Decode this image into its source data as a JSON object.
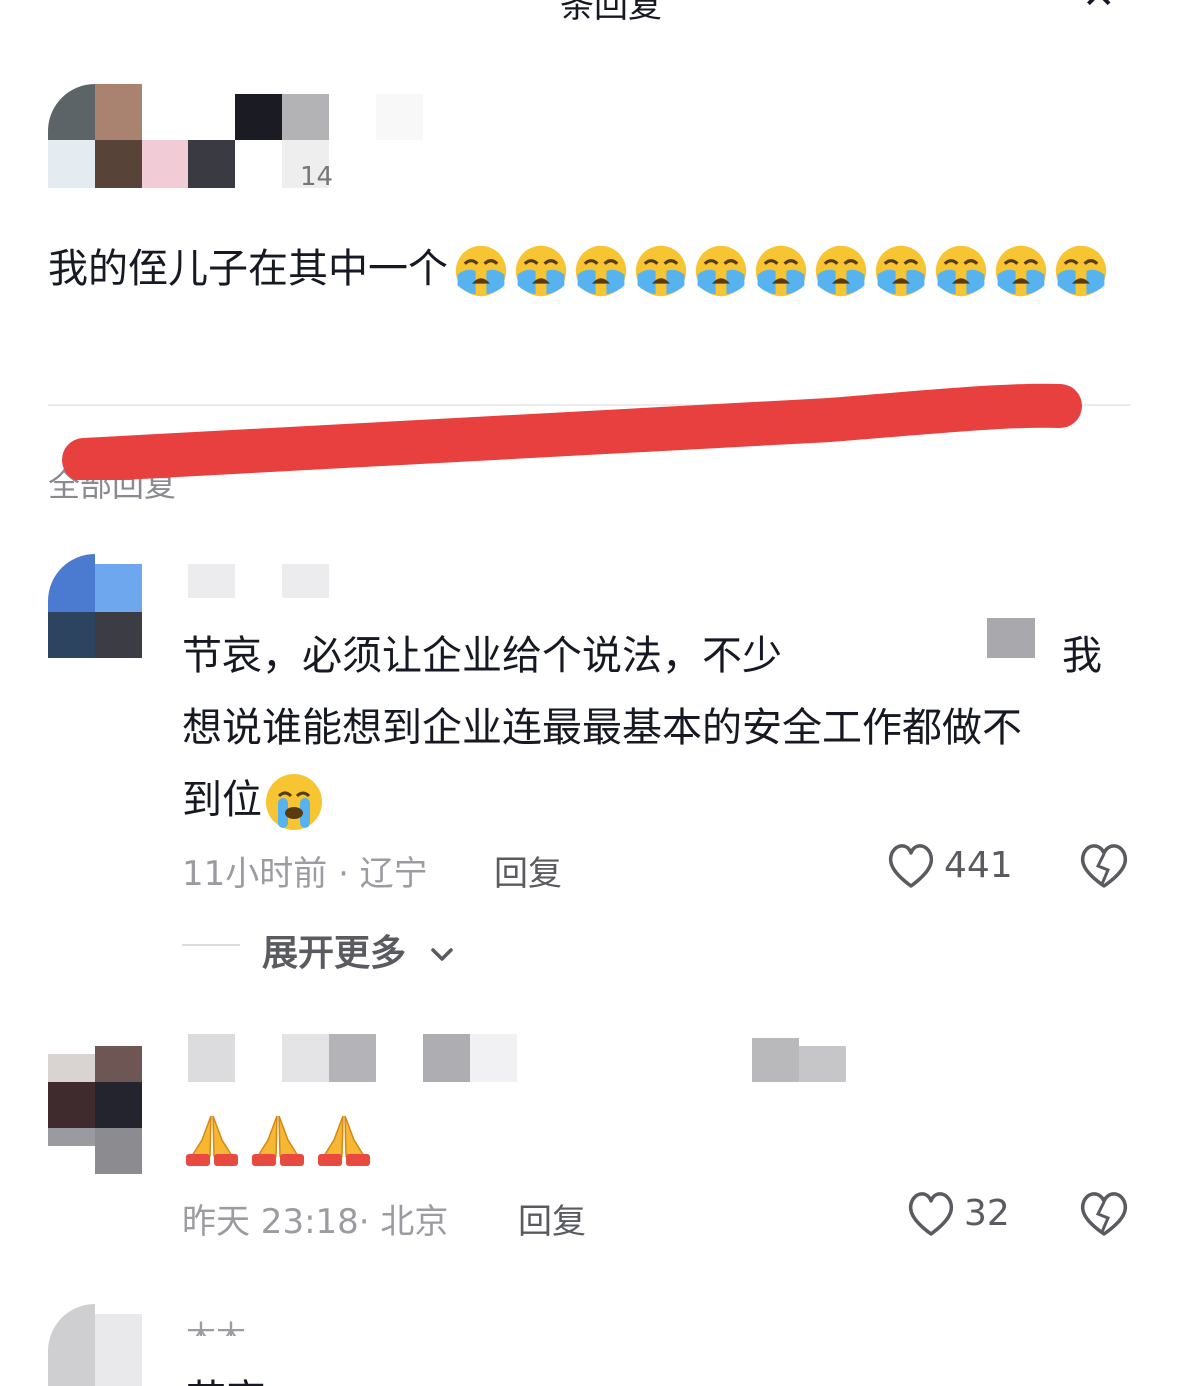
{
  "header": {
    "title_partial": "条回复",
    "close_glyph": "✕"
  },
  "post": {
    "author_time_partial": "14",
    "text": "我的侄儿子在其中一个",
    "emoji": "loudly-crying-face",
    "emoji_count": 11
  },
  "section": {
    "label": "全部回复"
  },
  "replies": [
    {
      "text_line1_a": "节哀，必须让企业给个说法，不少",
      "text_line1_b": "我",
      "text_line2": "想说谁能想到企业连最最基本的安全工作都做不",
      "text_line3": "到位",
      "emoji": "crying-face",
      "meta": "11小时前 · 辽宁",
      "reply_label": "回复",
      "likes": "441",
      "expand_label": "展开更多"
    },
    {
      "emoji": "folded-hands",
      "emoji_count": 3,
      "meta": "昨天 23:18· 北京",
      "reply_label": "回复",
      "likes": "32"
    },
    {
      "name_partial": "木木",
      "text_partial": "节哀"
    }
  ],
  "colors": {
    "redaction": "#e8403f",
    "text": "#161823",
    "meta": "#9b9ca1"
  }
}
